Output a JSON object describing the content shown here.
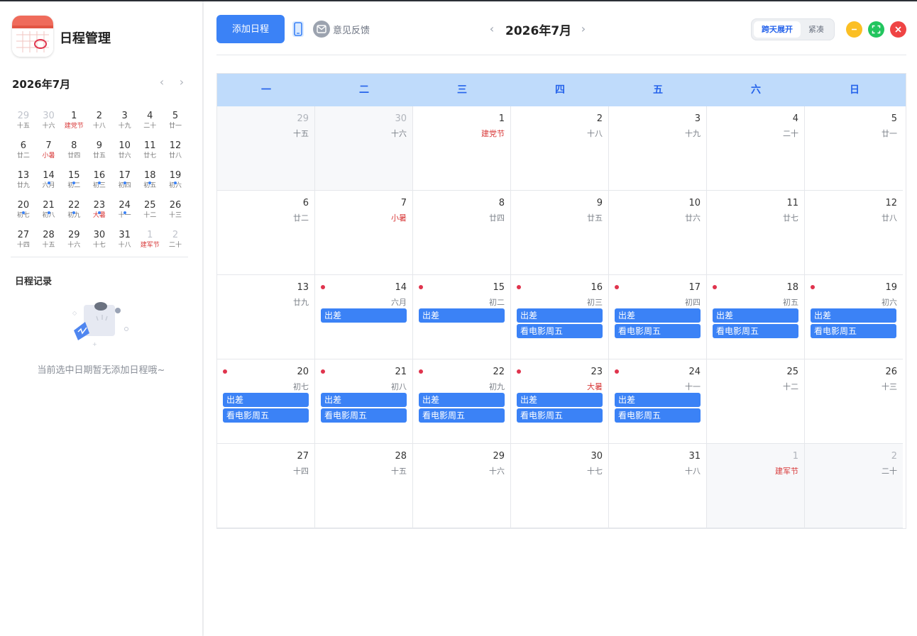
{
  "app": {
    "title": "日程管理"
  },
  "mini_calendar": {
    "title": "2026年7月",
    "days": [
      {
        "d": "29",
        "l": "十五",
        "other": true
      },
      {
        "d": "30",
        "l": "十六",
        "other": true
      },
      {
        "d": "1",
        "l": "建党节",
        "red": true
      },
      {
        "d": "2",
        "l": "十八"
      },
      {
        "d": "3",
        "l": "十九"
      },
      {
        "d": "4",
        "l": "二十"
      },
      {
        "d": "5",
        "l": "廿一"
      },
      {
        "d": "6",
        "l": "廿二"
      },
      {
        "d": "7",
        "l": "小暑",
        "red": true
      },
      {
        "d": "8",
        "l": "廿四"
      },
      {
        "d": "9",
        "l": "廿五"
      },
      {
        "d": "10",
        "l": "廿六"
      },
      {
        "d": "11",
        "l": "廿七"
      },
      {
        "d": "12",
        "l": "廿八"
      },
      {
        "d": "13",
        "l": "廿九"
      },
      {
        "d": "14",
        "l": "六月",
        "dot": true
      },
      {
        "d": "15",
        "l": "初二",
        "dot": true
      },
      {
        "d": "16",
        "l": "初三",
        "dot": true
      },
      {
        "d": "17",
        "l": "初四",
        "dot": true
      },
      {
        "d": "18",
        "l": "初五",
        "dot": true
      },
      {
        "d": "19",
        "l": "初六",
        "dot": true
      },
      {
        "d": "20",
        "l": "初七",
        "dot": true
      },
      {
        "d": "21",
        "l": "初八",
        "dot": true
      },
      {
        "d": "22",
        "l": "初九",
        "dot": true
      },
      {
        "d": "23",
        "l": "大暑",
        "red": true,
        "dot": true
      },
      {
        "d": "24",
        "l": "十一",
        "dot": true
      },
      {
        "d": "25",
        "l": "十二"
      },
      {
        "d": "26",
        "l": "十三"
      },
      {
        "d": "27",
        "l": "十四"
      },
      {
        "d": "28",
        "l": "十五"
      },
      {
        "d": "29",
        "l": "十六"
      },
      {
        "d": "30",
        "l": "十七"
      },
      {
        "d": "31",
        "l": "十八"
      },
      {
        "d": "1",
        "l": "建军节",
        "red": true,
        "other": true
      },
      {
        "d": "2",
        "l": "二十",
        "other": true
      }
    ]
  },
  "records": {
    "title": "日程记录",
    "empty_text": "当前选中日期暂无添加日程哦~"
  },
  "toolbar": {
    "add_label": "添加日程",
    "feedback_label": "意见反馈",
    "month_title": "2026年7月",
    "mode_expand": "跨天展开",
    "mode_compact": "紧凑"
  },
  "calendar": {
    "weekdays": [
      "一",
      "二",
      "三",
      "四",
      "五",
      "六",
      "日"
    ],
    "days": [
      {
        "d": "29",
        "l": "十五",
        "other": true
      },
      {
        "d": "30",
        "l": "十六",
        "other": true
      },
      {
        "d": "1",
        "l": "建党节",
        "red": true
      },
      {
        "d": "2",
        "l": "十八"
      },
      {
        "d": "3",
        "l": "十九"
      },
      {
        "d": "4",
        "l": "二十"
      },
      {
        "d": "5",
        "l": "廿一"
      },
      {
        "d": "6",
        "l": "廿二"
      },
      {
        "d": "7",
        "l": "小暑",
        "red": true
      },
      {
        "d": "8",
        "l": "廿四"
      },
      {
        "d": "9",
        "l": "廿五"
      },
      {
        "d": "10",
        "l": "廿六"
      },
      {
        "d": "11",
        "l": "廿七"
      },
      {
        "d": "12",
        "l": "廿八"
      },
      {
        "d": "13",
        "l": "廿九"
      },
      {
        "d": "14",
        "l": "六月",
        "events": [
          "出差"
        ]
      },
      {
        "d": "15",
        "l": "初二",
        "events": [
          "出差"
        ]
      },
      {
        "d": "16",
        "l": "初三",
        "events": [
          "出差",
          "看电影周五"
        ]
      },
      {
        "d": "17",
        "l": "初四",
        "events": [
          "出差",
          "看电影周五"
        ]
      },
      {
        "d": "18",
        "l": "初五",
        "events": [
          "出差",
          "看电影周五"
        ]
      },
      {
        "d": "19",
        "l": "初六",
        "events": [
          "出差",
          "看电影周五"
        ]
      },
      {
        "d": "20",
        "l": "初七",
        "events": [
          "出差",
          "看电影周五"
        ]
      },
      {
        "d": "21",
        "l": "初八",
        "events": [
          "出差",
          "看电影周五"
        ]
      },
      {
        "d": "22",
        "l": "初九",
        "events": [
          "出差",
          "看电影周五"
        ]
      },
      {
        "d": "23",
        "l": "大暑",
        "red": true,
        "events": [
          "出差",
          "看电影周五"
        ]
      },
      {
        "d": "24",
        "l": "十一",
        "events": [
          "出差",
          "看电影周五"
        ]
      },
      {
        "d": "25",
        "l": "十二"
      },
      {
        "d": "26",
        "l": "十三"
      },
      {
        "d": "27",
        "l": "十四"
      },
      {
        "d": "28",
        "l": "十五"
      },
      {
        "d": "29",
        "l": "十六"
      },
      {
        "d": "30",
        "l": "十七"
      },
      {
        "d": "31",
        "l": "十八"
      },
      {
        "d": "1",
        "l": "建军节",
        "red": true,
        "other": true
      },
      {
        "d": "2",
        "l": "二十",
        "other": true
      }
    ]
  },
  "colors": {
    "accent": "#3b82f6",
    "header_bg": "#bfdbfb",
    "holiday_red": "#d83a3a",
    "event_dot": "#e0344d"
  },
  "icons": {
    "phone": "phone-icon",
    "feedback": "mail-icon",
    "prev": "chevron-left-icon",
    "next": "chevron-right-icon",
    "minimize": "minus-icon",
    "maximize": "expand-icon",
    "close": "close-icon"
  }
}
